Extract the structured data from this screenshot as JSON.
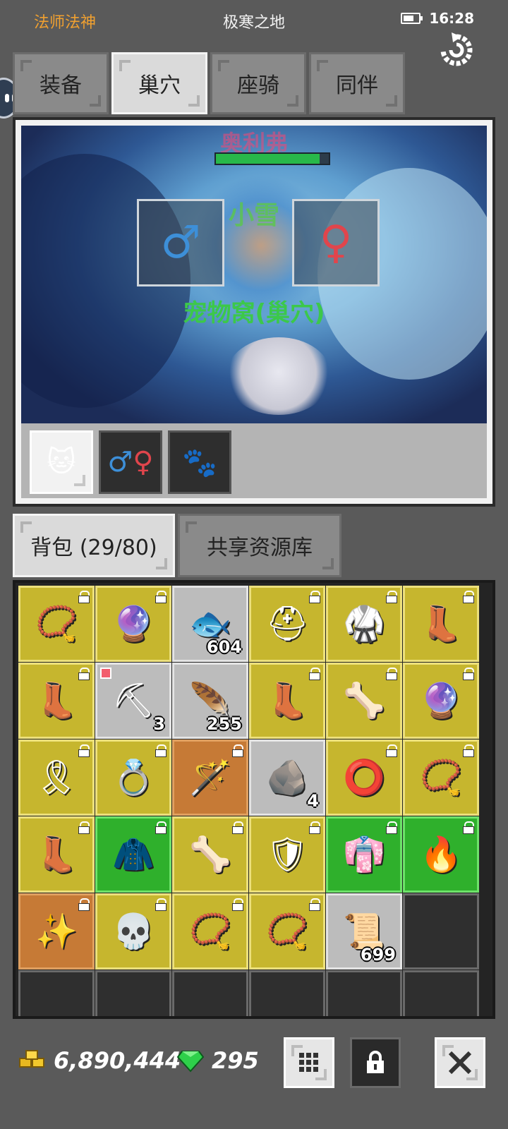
{
  "status": {
    "left_text": "法师法神",
    "title": "极寒之地",
    "time": "16:28"
  },
  "top_tabs": [
    {
      "label": "装备",
      "active": false
    },
    {
      "label": "巢穴",
      "active": true
    },
    {
      "label": "座骑",
      "active": false
    },
    {
      "label": "同伴",
      "active": false
    }
  ],
  "nest": {
    "pet_name": "奥利弗",
    "hp_fraction": 0.92,
    "nickname": "小雪",
    "male_symbol": "♂",
    "female_symbol": "♀",
    "label": "宠物窝(巢穴)",
    "subtabs": [
      {
        "icon": "cat-icon",
        "active": true
      },
      {
        "icon": "gender-icon",
        "active": false
      },
      {
        "icon": "paws-icon",
        "active": false
      }
    ]
  },
  "bag_tabs": {
    "bag_label": "背包 (29/80)",
    "shared_label": "共享资源库"
  },
  "inventory": [
    {
      "rarity": "yellow",
      "icon": "emerald-necklace-icon",
      "locked": true
    },
    {
      "rarity": "yellow",
      "icon": "orb-staff-icon",
      "locked": true
    },
    {
      "rarity": "gray",
      "icon": "fish-icon",
      "count": "604"
    },
    {
      "rarity": "yellow",
      "icon": "helmet-icon",
      "locked": true
    },
    {
      "rarity": "yellow",
      "icon": "chest-armor-icon",
      "locked": true
    },
    {
      "rarity": "yellow",
      "icon": "boots-icon",
      "locked": true
    },
    {
      "rarity": "yellow",
      "icon": "boots-icon",
      "locked": true
    },
    {
      "rarity": "gray",
      "icon": "shovel-icon",
      "count": "3",
      "new": true
    },
    {
      "rarity": "gray",
      "icon": "blue-feather-icon",
      "count": "255"
    },
    {
      "rarity": "yellow",
      "icon": "boots-icon",
      "locked": true
    },
    {
      "rarity": "yellow",
      "icon": "leg-armor-icon",
      "locked": true
    },
    {
      "rarity": "yellow",
      "icon": "orb-staff-icon",
      "locked": true
    },
    {
      "rarity": "yellow",
      "icon": "belt-icon",
      "locked": true
    },
    {
      "rarity": "yellow",
      "icon": "gold-ring-icon",
      "locked": true
    },
    {
      "rarity": "orange",
      "icon": "wand-icon",
      "locked": true
    },
    {
      "rarity": "gray",
      "icon": "ore-icon",
      "count": "4"
    },
    {
      "rarity": "yellow",
      "icon": "ruby-belt-icon",
      "locked": true
    },
    {
      "rarity": "yellow",
      "icon": "ruby-necklace-icon",
      "locked": true
    },
    {
      "rarity": "yellow",
      "icon": "boots-icon",
      "locked": true
    },
    {
      "rarity": "green",
      "icon": "green-robe-icon",
      "locked": true
    },
    {
      "rarity": "yellow",
      "icon": "leg-armor-icon",
      "locked": true
    },
    {
      "rarity": "yellow",
      "icon": "chainmail-icon",
      "locked": true
    },
    {
      "rarity": "green",
      "icon": "red-robe-icon",
      "locked": true
    },
    {
      "rarity": "green",
      "icon": "fire-staff-icon",
      "locked": true
    },
    {
      "rarity": "orange",
      "icon": "gold-staff-icon",
      "locked": true
    },
    {
      "rarity": "yellow",
      "icon": "horned-skull-icon",
      "locked": true
    },
    {
      "rarity": "yellow",
      "icon": "ruby-necklace-icon",
      "locked": true
    },
    {
      "rarity": "yellow",
      "icon": "emerald-necklace-icon",
      "locked": true
    },
    {
      "rarity": "gray",
      "icon": "scroll-icon",
      "count": "699"
    },
    {
      "rarity": "empty"
    },
    {
      "rarity": "empty"
    },
    {
      "rarity": "empty"
    },
    {
      "rarity": "empty"
    },
    {
      "rarity": "empty"
    },
    {
      "rarity": "empty"
    },
    {
      "rarity": "empty"
    }
  ],
  "currency": {
    "gold": "6,890,444",
    "gems": "295"
  },
  "colors": {
    "accent_orange": "#f0a030",
    "rarity_yellow": "#c6b62e",
    "rarity_green": "#2fb02c",
    "rarity_orange": "#c67a36"
  }
}
